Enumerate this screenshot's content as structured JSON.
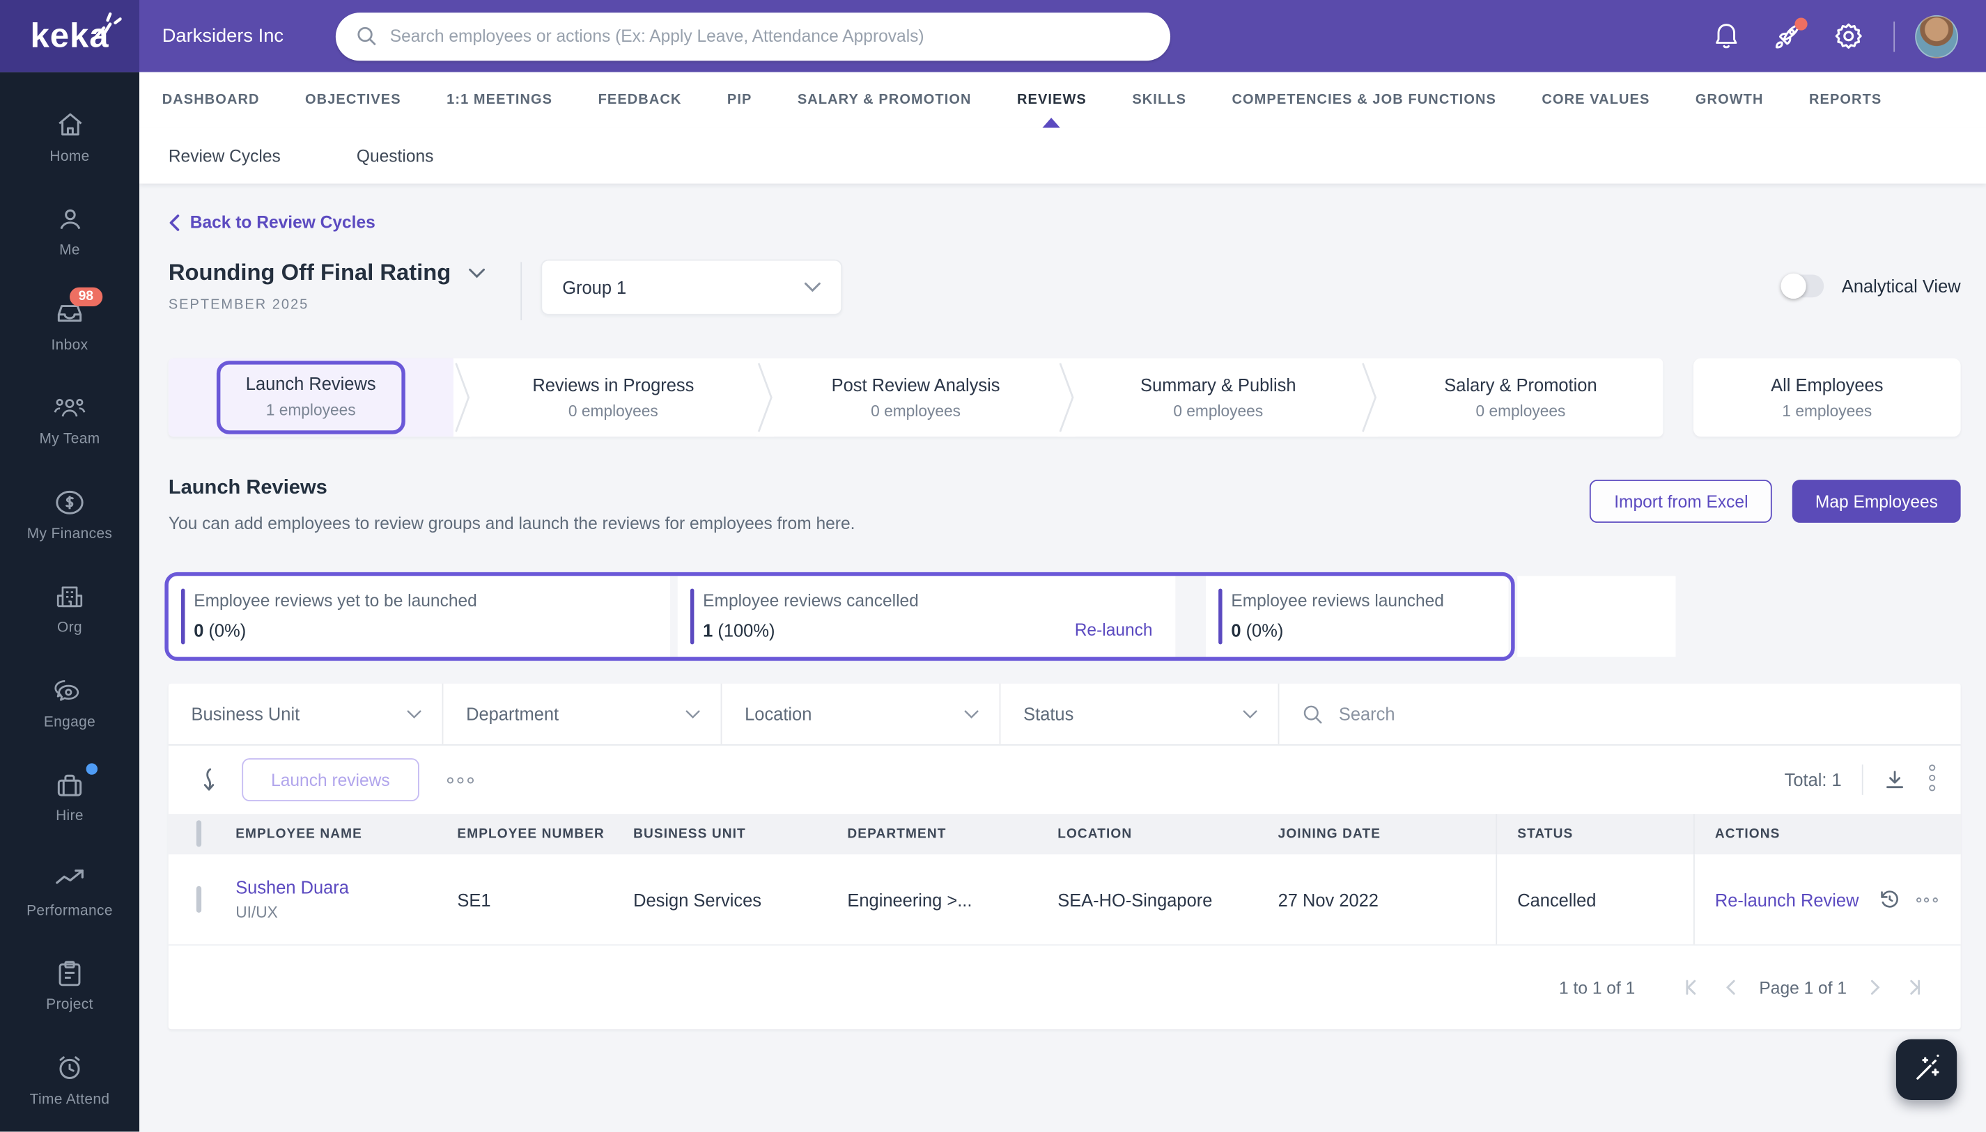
{
  "header": {
    "logo": "keka",
    "company": "Darksiders Inc",
    "search_placeholder": "Search employees or actions (Ex: Apply Leave, Attendance Approvals)",
    "notification_dot_color": "#ee6f62"
  },
  "sidebar": {
    "items": [
      {
        "label": "Home",
        "icon": "home-icon"
      },
      {
        "label": "Me",
        "icon": "person-icon"
      },
      {
        "label": "Inbox",
        "icon": "inbox-icon",
        "badge": "98"
      },
      {
        "label": "My Team",
        "icon": "team-icon"
      },
      {
        "label": "My Finances",
        "icon": "dollar-icon"
      },
      {
        "label": "Org",
        "icon": "building-icon"
      },
      {
        "label": "Engage",
        "icon": "chat-icon"
      },
      {
        "label": "Hire",
        "icon": "briefcase-icon",
        "dot": true
      },
      {
        "label": "Performance",
        "icon": "trend-icon"
      },
      {
        "label": "Project",
        "icon": "clipboard-icon"
      },
      {
        "label": "Time Attend",
        "icon": "alarm-clock-icon"
      }
    ]
  },
  "nav_tabs": {
    "active": "REVIEWS",
    "items": [
      {
        "label": "DASHBOARD"
      },
      {
        "label": "OBJECTIVES"
      },
      {
        "label": "1:1 MEETINGS"
      },
      {
        "label": "FEEDBACK"
      },
      {
        "label": "PIP"
      },
      {
        "label": "SALARY & PROMOTION"
      },
      {
        "label": "REVIEWS"
      },
      {
        "label": "SKILLS"
      },
      {
        "label": "COMPETENCIES & JOB FUNCTIONS"
      },
      {
        "label": "CORE VALUES"
      },
      {
        "label": "GROWTH"
      },
      {
        "label": "REPORTS"
      }
    ]
  },
  "sub_tabs": {
    "items": [
      {
        "label": "Review Cycles"
      },
      {
        "label": "Questions"
      }
    ]
  },
  "breadcrumb": {
    "back_label": "Back to Review Cycles"
  },
  "cycle": {
    "title": "Rounding Off Final Rating",
    "period": "SEPTEMBER 2025",
    "group": "Group 1",
    "analytical_view_label": "Analytical View",
    "analytical_view_state": "off"
  },
  "stepper": {
    "stages": [
      {
        "label": "Launch Reviews",
        "count": "1 employees",
        "active": true
      },
      {
        "label": "Reviews in Progress",
        "count": "0 employees",
        "active": false
      },
      {
        "label": "Post Review Analysis",
        "count": "0 employees",
        "active": false
      },
      {
        "label": "Summary & Publish",
        "count": "0 employees",
        "active": false
      },
      {
        "label": "Salary & Promotion",
        "count": "0 employees",
        "active": false
      }
    ],
    "all_employees": {
      "label": "All Employees",
      "count": "1 employees"
    }
  },
  "launch_section": {
    "title": "Launch Reviews",
    "description": "You can add employees to review groups and launch the reviews for employees from here.",
    "import_label": "Import from Excel",
    "map_label": "Map Employees"
  },
  "stats": {
    "cards": [
      {
        "label": "Employee reviews yet to be launched",
        "value": "0",
        "percent": "(0%)"
      },
      {
        "label": "Employee reviews cancelled",
        "value": "1",
        "percent": "(100%)",
        "link": "Re-launch"
      },
      {
        "label": "Employee reviews launched",
        "value": "0",
        "percent": "(0%)"
      }
    ]
  },
  "filters": {
    "dropdowns": [
      {
        "label": "Business Unit"
      },
      {
        "label": "Department"
      },
      {
        "label": "Location"
      },
      {
        "label": "Status"
      }
    ],
    "search_placeholder": "Search"
  },
  "toolbar": {
    "launch_label": "Launch reviews",
    "total": "Total: 1"
  },
  "table": {
    "columns": [
      {
        "label": "EMPLOYEE NAME"
      },
      {
        "label": "EMPLOYEE NUMBER"
      },
      {
        "label": "BUSINESS UNIT"
      },
      {
        "label": "DEPARTMENT"
      },
      {
        "label": "LOCATION"
      },
      {
        "label": "JOINING DATE"
      },
      {
        "label": "STATUS"
      },
      {
        "label": "ACTIONS"
      }
    ],
    "rows": [
      {
        "name": "Sushen Duara",
        "role": "UI/UX",
        "number": "SE1",
        "business_unit": "Design Services",
        "department": "Engineering >...",
        "location": "SEA-HO-Singapore",
        "joining_date": "27 Nov 2022",
        "status": "Cancelled",
        "action": "Re-launch Review"
      }
    ]
  },
  "pagination": {
    "range": "1 to 1 of 1",
    "page": "Page 1 of 1"
  },
  "colors": {
    "accent": "#5b4ac0",
    "highlight_border": "#6a58d8",
    "topbar": "#5a4bab",
    "logo_bg": "#3f3688",
    "sidebar_bg": "#17202f",
    "badge_red": "#ee6f62",
    "hire_dot_blue": "#4f9cf5",
    "content_bg": "#f4f5f8"
  }
}
